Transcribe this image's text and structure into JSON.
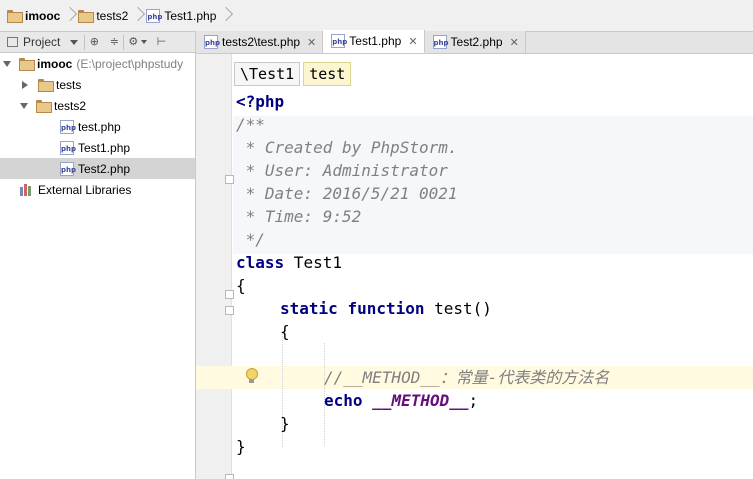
{
  "breadcrumb": {
    "items": [
      {
        "label": "imooc",
        "type": "folder"
      },
      {
        "label": "tests2",
        "type": "folder"
      },
      {
        "label": "Test1.php",
        "type": "php-file"
      }
    ]
  },
  "project_panel": {
    "title": "Project",
    "tree": [
      {
        "label": "imooc",
        "path": "(E:\\project\\phpstudy",
        "type": "root"
      },
      {
        "label": "tests",
        "type": "folder"
      },
      {
        "label": "tests2",
        "type": "folder"
      },
      {
        "label": "test.php",
        "type": "php-file"
      },
      {
        "label": "Test1.php",
        "type": "php-file"
      },
      {
        "label": "Test2.php",
        "type": "php-file",
        "selected": true
      },
      {
        "label": "External Libraries",
        "type": "library"
      }
    ]
  },
  "tabs": [
    {
      "label": "tests2\\test.php",
      "active": false
    },
    {
      "label": "Test1.php",
      "active": true
    },
    {
      "label": "Test2.php",
      "active": false
    }
  ],
  "editor": {
    "hint_path": "\\Test1",
    "hint_method": "test",
    "lines": {
      "php_open": "<?php",
      "doc_open": "/**",
      "doc_created": " * Created by PhpStorm.",
      "doc_user": " * User: Administrator",
      "doc_date": " * Date: 2016/5/21 0021",
      "doc_time": " * Time: 9:52",
      "doc_close": " */",
      "class_kw": "class",
      "class_name": " Test1",
      "brace_open": "{",
      "static_kw": "static",
      "function_kw": "function",
      "method_sig": " test()",
      "method_brace_open": "{",
      "comment": "//__METHOD__：常量-代表类的方法名",
      "echo_kw": "echo",
      "magic_const": "__METHOD__",
      "semicolon": ";",
      "method_brace_close": "}",
      "brace_close": "}"
    }
  },
  "colors": {
    "keyword": "#000080",
    "comment": "#808080",
    "magic_constant": "#660e7a",
    "caret_row": "#fffae0"
  }
}
